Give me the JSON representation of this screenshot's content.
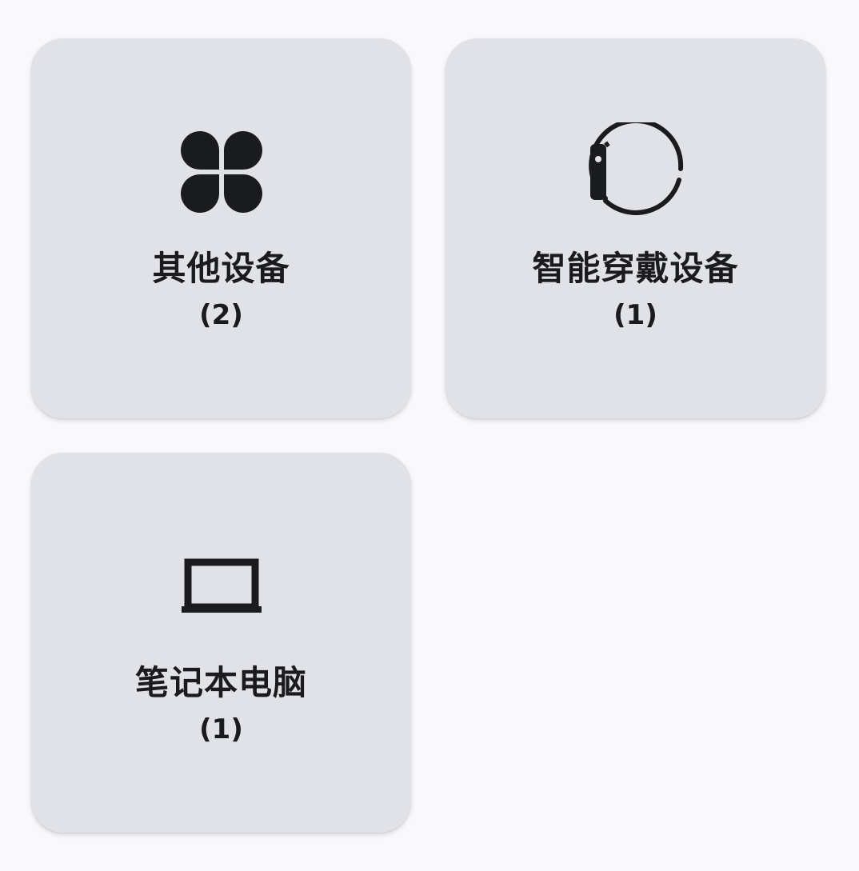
{
  "devices": [
    {
      "id": "other",
      "icon": "four-petal-grid-icon",
      "name": "其他设备",
      "count": "(2)"
    },
    {
      "id": "wearable",
      "icon": "smartwatch-icon",
      "name": "智能穿戴设备",
      "count": "(1)"
    },
    {
      "id": "laptop",
      "icon": "laptop-icon",
      "name": "笔记本电脑",
      "count": "(1)"
    }
  ],
  "colors": {
    "background": "#f8f8fd",
    "card": "#e1e2e7",
    "text": "#1a1b1f"
  }
}
